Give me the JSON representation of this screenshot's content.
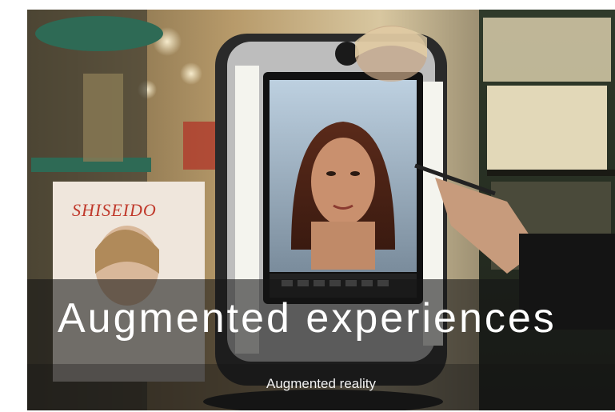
{
  "title": "Augmented experiences",
  "caption": "Augmented reality",
  "poster_brand": "SHISEIDO"
}
